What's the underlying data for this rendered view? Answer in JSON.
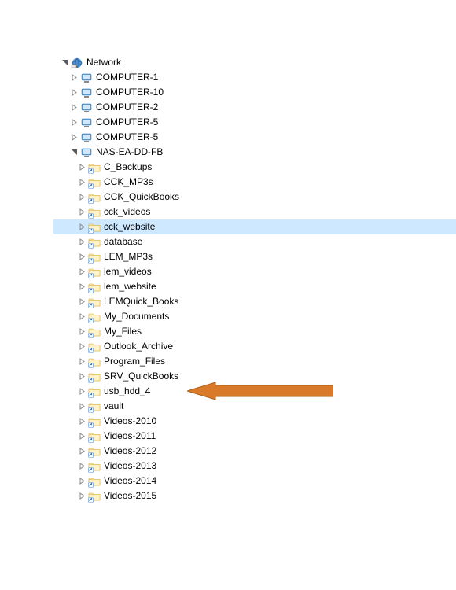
{
  "root": {
    "label": "Network",
    "iconType": "network",
    "expanded": true
  },
  "computers": [
    {
      "label": "COMPUTER-1",
      "iconType": "computer"
    },
    {
      "label": "COMPUTER-10",
      "iconType": "computer"
    },
    {
      "label": "COMPUTER-2",
      "iconType": "computer"
    },
    {
      "label": "COMPUTER-5",
      "iconType": "computer"
    },
    {
      "label": "COMPUTER-5",
      "iconType": "computer"
    }
  ],
  "nas": {
    "label": "NAS-EA-DD-FB",
    "iconType": "computer",
    "expanded": true
  },
  "folders": [
    {
      "label": "C_Backups"
    },
    {
      "label": "CCK_MP3s"
    },
    {
      "label": "CCK_QuickBooks"
    },
    {
      "label": "cck_videos"
    },
    {
      "label": "cck_website",
      "selected": true
    },
    {
      "label": "database"
    },
    {
      "label": "LEM_MP3s"
    },
    {
      "label": "lem_videos"
    },
    {
      "label": "lem_website"
    },
    {
      "label": "LEMQuick_Books"
    },
    {
      "label": "My_Documents"
    },
    {
      "label": "My_Files"
    },
    {
      "label": "Outlook_Archive"
    },
    {
      "label": "Program_Files"
    },
    {
      "label": "SRV_QuickBooks"
    },
    {
      "label": "usb_hdd_4",
      "arrowTarget": true
    },
    {
      "label": "vault"
    },
    {
      "label": "Videos-2010"
    },
    {
      "label": "Videos-2011"
    },
    {
      "label": "Videos-2012"
    },
    {
      "label": "Videos-2013"
    },
    {
      "label": "Videos-2014"
    },
    {
      "label": "Videos-2015"
    }
  ],
  "annotation": {
    "arrowColor": "#d97a2a",
    "borderColor": "#b35f14"
  }
}
